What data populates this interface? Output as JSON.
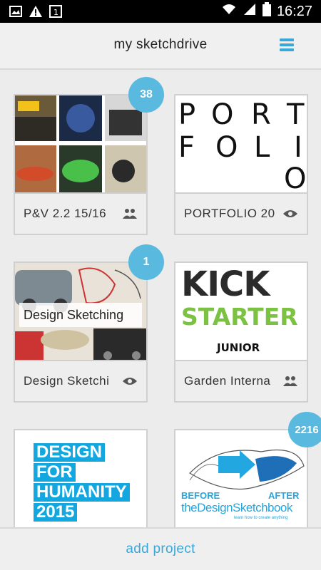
{
  "status_bar": {
    "time": "16:27",
    "icons": [
      "image-icon",
      "warning-icon",
      "sim-icon",
      "wifi-icon",
      "signal-icon",
      "battery-icon"
    ]
  },
  "header": {
    "title": "my sketchdrive",
    "menu_icon": "hamburger-menu-icon",
    "accent": "#3ba7d7"
  },
  "projects": [
    {
      "name": "P&V 2.2 15/16",
      "badge": "38",
      "icon": "group-icon"
    },
    {
      "name": "PORTFOLIO 20",
      "badge": "",
      "icon": "eye-icon",
      "thumb_text": [
        "P",
        "O",
        "R",
        "T",
        "F",
        "O",
        "L",
        "I",
        "O"
      ]
    },
    {
      "name": "Design Sketchi",
      "badge": "1",
      "icon": "eye-icon",
      "thumb_label": "Design Sketching"
    },
    {
      "name": "Garden Interna",
      "badge": "",
      "icon": "group-icon",
      "thumb_lines": [
        "KICK",
        "STARTER",
        "JUNIOR"
      ]
    },
    {
      "name": "",
      "badge": "",
      "icon": "",
      "thumb_lines": [
        "DESIGN",
        "FOR",
        "HUMANITY",
        "2015"
      ]
    },
    {
      "name": "",
      "badge": "2216",
      "icon": "",
      "thumb_lines": [
        "BEFORE",
        "AFTER",
        "theDesignSketchbook",
        "learn how to create anything"
      ]
    }
  ],
  "footer": {
    "add_label": "add project"
  },
  "colors": {
    "badge": "#5ab9df",
    "kick_green": "#7cc242",
    "dfh_blue": "#14a6de"
  }
}
